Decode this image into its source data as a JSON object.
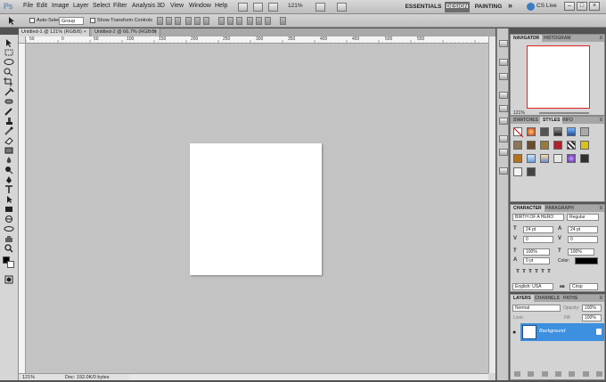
{
  "app": {
    "logo": "Ps"
  },
  "menu": [
    "File",
    "Edit",
    "Image",
    "Layer",
    "Select",
    "Filter",
    "Analysis",
    "3D",
    "View",
    "Window",
    "Help"
  ],
  "menubar": {
    "zoom": "121%"
  },
  "workspaces": {
    "essentials": "ESSENTIALS",
    "design": "DESIGN",
    "painting": "PAINTING",
    "more": "»"
  },
  "cs_live": "CS Live",
  "window_controls": [
    "–",
    "□",
    "×"
  ],
  "options": {
    "auto_select_label": "Auto-Select:",
    "auto_select_value": "Group",
    "show_transform_label": "Show Transform Controls"
  },
  "tabs": [
    {
      "label": "Untitled-1 @ 121% (RGB/8)",
      "close": "×"
    },
    {
      "label": "Untitled-2 @ 66.7% (RGB/8)",
      "close": "×"
    }
  ],
  "ruler_ticks": [
    "50",
    "0",
    "50",
    "100",
    "150",
    "200",
    "250",
    "300",
    "350",
    "400",
    "450",
    "500",
    "550"
  ],
  "status": {
    "zoom": "121%",
    "doc": "Doc: 192.0K/0 bytes"
  },
  "navigator": {
    "tabs": [
      "NAVIGATOR",
      "HISTOGRAM"
    ],
    "zoom": "121%"
  },
  "swatches_panel": {
    "tabs": [
      "SWATCHES",
      "STYLES",
      "INFO"
    ]
  },
  "character": {
    "tabs": [
      "CHARACTER",
      "PARAGRAPH"
    ],
    "font_family": "BIRTH OF A HERO",
    "font_style": "Regular",
    "size": "24 pt",
    "leading": "24 pt",
    "kerning": "0",
    "tracking": "0",
    "vscale": "100%",
    "hscale": "100%",
    "baseline": "0 pt",
    "color_label": "Color:",
    "language": "English: USA",
    "aa_label": "aa",
    "antialias": "Crisp"
  },
  "layers": {
    "tabs": [
      "LAYERS",
      "CHANNELS",
      "PATHS"
    ],
    "blend_mode": "Normal",
    "opacity_label": "Opacity:",
    "opacity": "100%",
    "lock_label": "Lock:",
    "fill_label": "Fill:",
    "fill": "100%",
    "layer_name": "Background"
  }
}
